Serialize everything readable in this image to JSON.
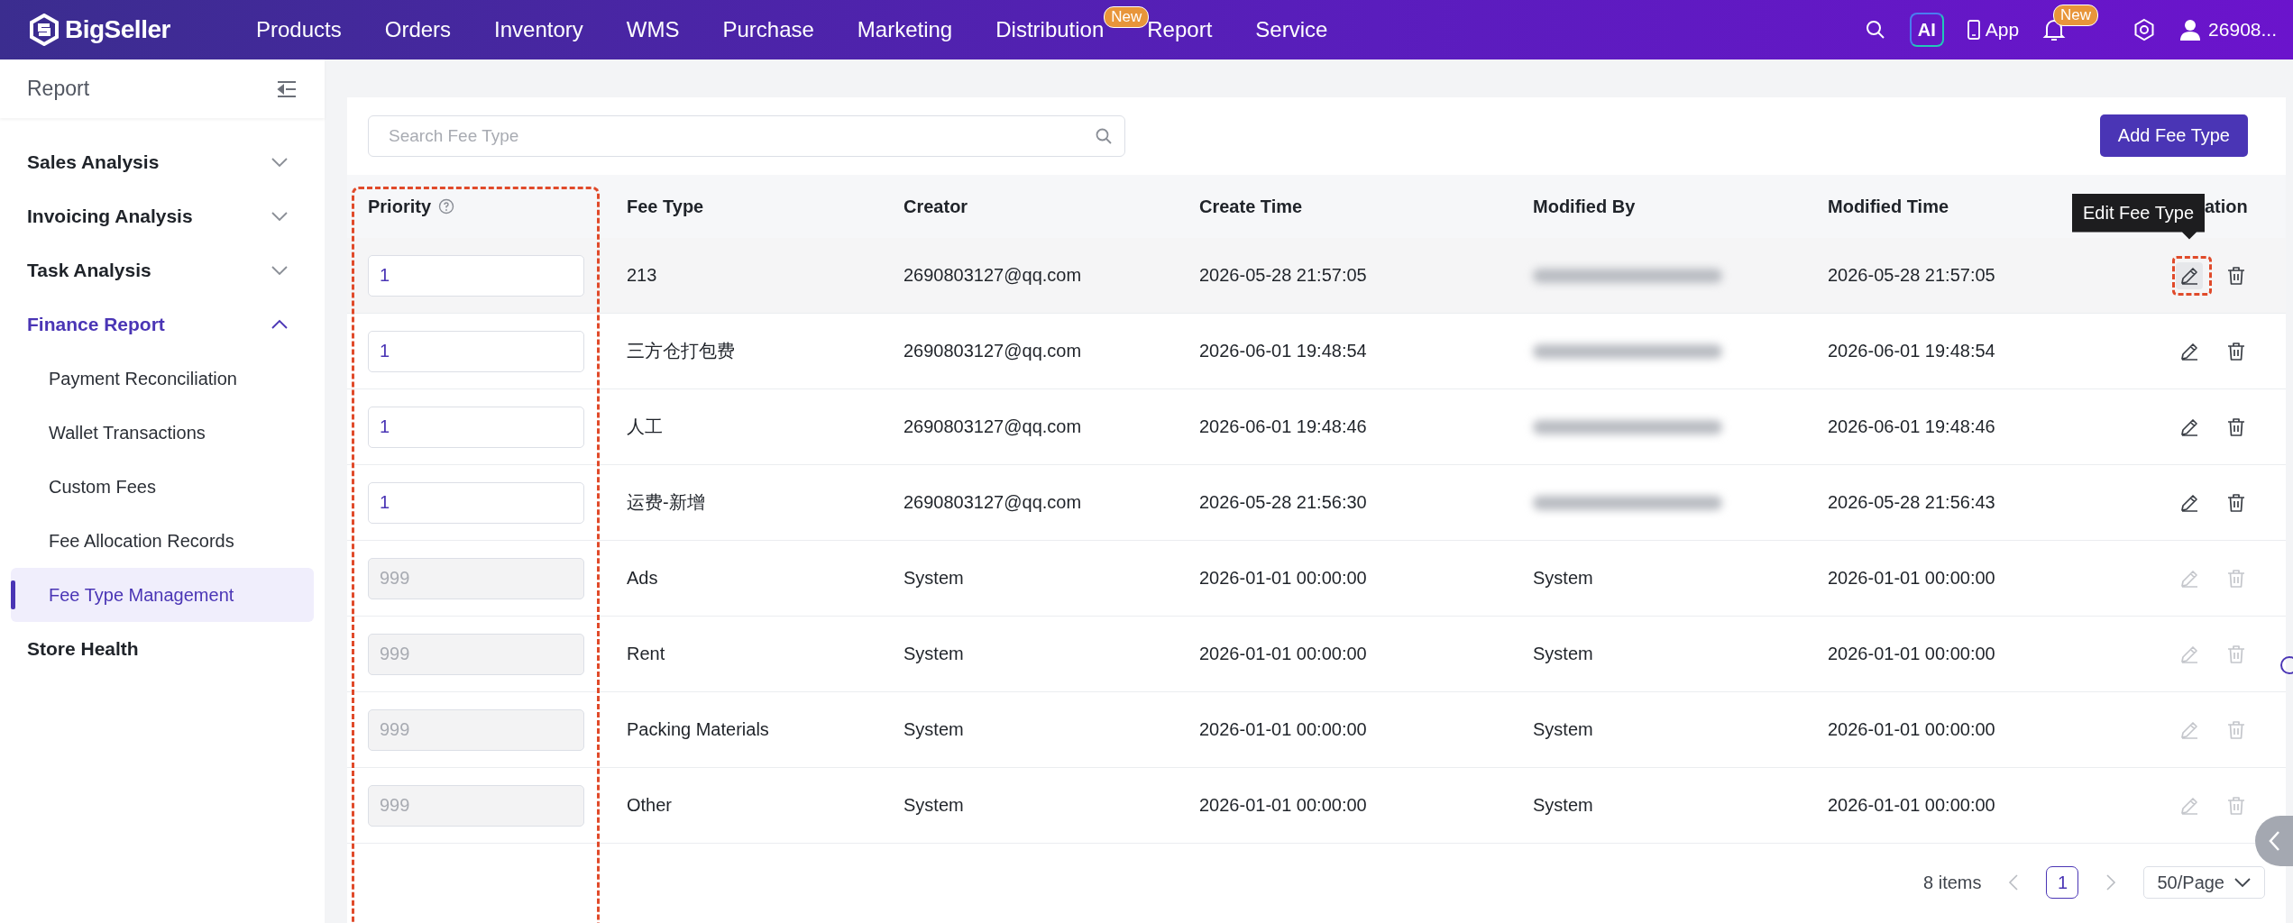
{
  "topbar": {
    "logo": "BigSeller",
    "nav": [
      {
        "label": "Products"
      },
      {
        "label": "Orders"
      },
      {
        "label": "Inventory"
      },
      {
        "label": "WMS"
      },
      {
        "label": "Purchase"
      },
      {
        "label": "Marketing"
      },
      {
        "label": "Distribution",
        "badge": "New"
      },
      {
        "label": "Report"
      },
      {
        "label": "Service"
      }
    ],
    "ai": "AI",
    "app": "App",
    "bell_badge": "New",
    "user": "26908..."
  },
  "sidebar": {
    "title": "Report",
    "items": [
      {
        "label": "Sales Analysis",
        "kind": "group",
        "expanded": false,
        "selected": false
      },
      {
        "label": "Invoicing Analysis",
        "kind": "group",
        "expanded": false,
        "selected": false
      },
      {
        "label": "Task Analysis",
        "kind": "group",
        "expanded": false,
        "selected": false
      },
      {
        "label": "Finance Report",
        "kind": "group",
        "expanded": true,
        "selected": true,
        "children": [
          {
            "label": "Payment Reconciliation",
            "selected": false
          },
          {
            "label": "Wallet Transactions",
            "selected": false
          },
          {
            "label": "Custom Fees",
            "selected": false
          },
          {
            "label": "Fee Allocation Records",
            "selected": false
          },
          {
            "label": "Fee Type Management",
            "selected": true
          }
        ]
      },
      {
        "label": "Store Health",
        "kind": "link",
        "selected": false
      }
    ]
  },
  "search": {
    "placeholder": "Search Fee Type"
  },
  "add_button": "Add Fee Type",
  "table": {
    "columns": [
      "Priority",
      "Fee Type",
      "Creator",
      "Create Time",
      "Modified By",
      "Modified Time",
      "ation"
    ],
    "priority_column_marked": true,
    "rows": [
      {
        "priority": "1",
        "priority_disabled": false,
        "fee_type": "213",
        "creator": "2690803127@qq.com",
        "create_time": "2026-05-28 21:57:05",
        "modified_by_blurred": true,
        "modified_time": "2026-05-28 21:57:05",
        "actions_disabled": false,
        "hovered": true,
        "edit_marked": true,
        "tooltip": "Edit Fee Type"
      },
      {
        "priority": "1",
        "priority_disabled": false,
        "fee_type": "三方仓打包费",
        "creator": "2690803127@qq.com",
        "create_time": "2026-06-01 19:48:54",
        "modified_by_blurred": true,
        "modified_time": "2026-06-01 19:48:54",
        "actions_disabled": false,
        "hovered": false,
        "edit_marked": false
      },
      {
        "priority": "1",
        "priority_disabled": false,
        "fee_type": "人工",
        "creator": "2690803127@qq.com",
        "create_time": "2026-06-01 19:48:46",
        "modified_by_blurred": true,
        "modified_time": "2026-06-01 19:48:46",
        "actions_disabled": false,
        "hovered": false,
        "edit_marked": false
      },
      {
        "priority": "1",
        "priority_disabled": false,
        "fee_type": "运费-新增",
        "creator": "2690803127@qq.com",
        "create_time": "2026-05-28 21:56:30",
        "modified_by_blurred": true,
        "modified_time": "2026-05-28 21:56:43",
        "actions_disabled": false,
        "hovered": false,
        "edit_marked": false
      },
      {
        "priority": "999",
        "priority_disabled": true,
        "fee_type": "Ads",
        "creator": "System",
        "create_time": "2026-01-01 00:00:00",
        "modified_by_blurred": false,
        "modified_by": "System",
        "modified_time": "2026-01-01 00:00:00",
        "actions_disabled": true,
        "hovered": false,
        "edit_marked": false
      },
      {
        "priority": "999",
        "priority_disabled": true,
        "fee_type": "Rent",
        "creator": "System",
        "create_time": "2026-01-01 00:00:00",
        "modified_by_blurred": false,
        "modified_by": "System",
        "modified_time": "2026-01-01 00:00:00",
        "actions_disabled": true,
        "hovered": false,
        "edit_marked": false
      },
      {
        "priority": "999",
        "priority_disabled": true,
        "fee_type": "Packing Materials",
        "creator": "System",
        "create_time": "2026-01-01 00:00:00",
        "modified_by_blurred": false,
        "modified_by": "System",
        "modified_time": "2026-01-01 00:00:00",
        "actions_disabled": true,
        "hovered": false,
        "edit_marked": false
      },
      {
        "priority": "999",
        "priority_disabled": true,
        "fee_type": "Other",
        "creator": "System",
        "create_time": "2026-01-01 00:00:00",
        "modified_by_blurred": false,
        "modified_by": "System",
        "modified_time": "2026-01-01 00:00:00",
        "actions_disabled": true,
        "hovered": false,
        "edit_marked": false
      }
    ]
  },
  "pagination": {
    "total": "8 items",
    "pages": [
      {
        "label": "1",
        "selected": true
      }
    ],
    "page_size": "50/Page"
  }
}
